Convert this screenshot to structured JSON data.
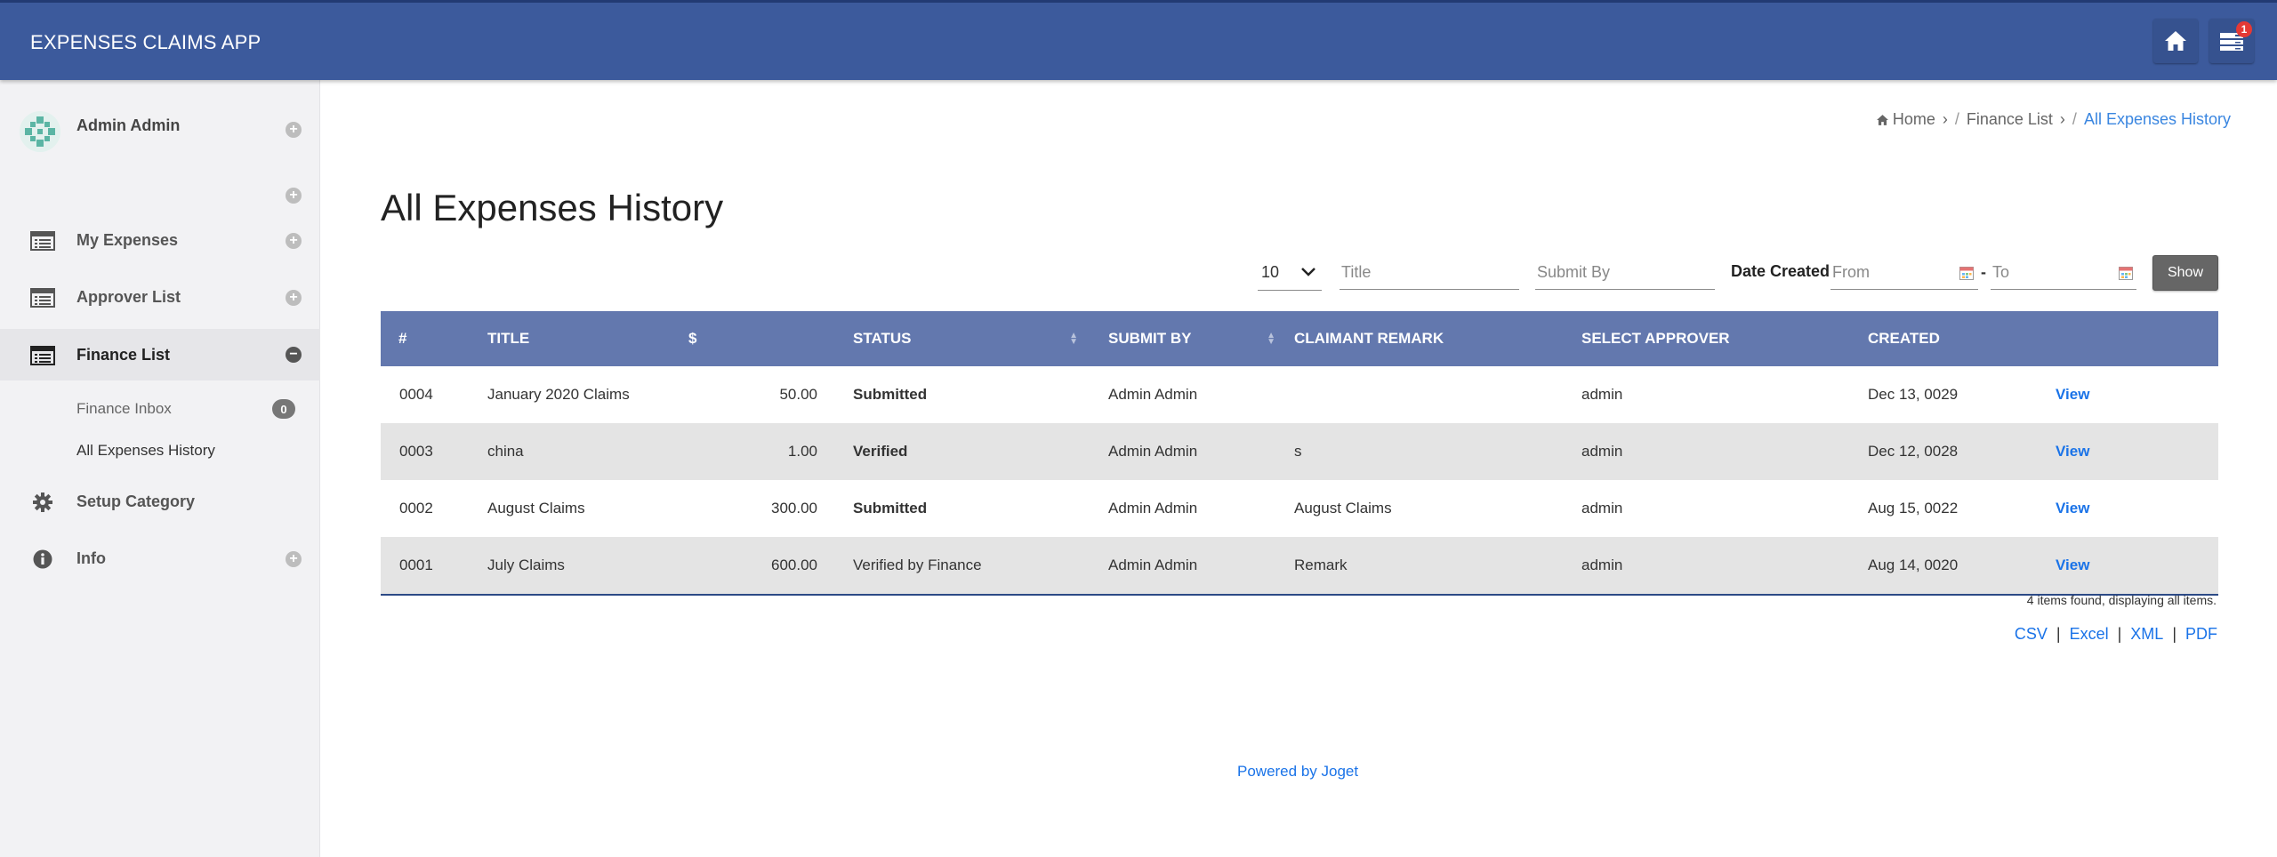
{
  "app": {
    "title": "EXPENSES CLAIMS APP",
    "notification_count": "1"
  },
  "header_icons": {
    "home": "home-icon",
    "tasks": "inbox-tray-icon"
  },
  "user": {
    "name": "Admin Admin",
    "avatar": "avatar-icon"
  },
  "sidebar": {
    "items": [
      {
        "label": "My Expenses",
        "icon": "list-icon",
        "toggle": "+"
      },
      {
        "label": "Approver List",
        "icon": "list-icon",
        "toggle": "+"
      },
      {
        "label": "Finance List",
        "icon": "list-icon",
        "toggle": "−"
      },
      {
        "label": "Setup Category",
        "icon": "gear-icon"
      },
      {
        "label": "Info",
        "icon": "info-icon",
        "toggle": "+"
      }
    ],
    "sub_items": [
      {
        "label": "Finance Inbox",
        "count": "0"
      },
      {
        "label": "All Expenses History"
      }
    ]
  },
  "breadcrumb": {
    "home": "Home",
    "parent": "Finance List",
    "current": "All Expenses History"
  },
  "page": {
    "title": "All Expenses History"
  },
  "filters": {
    "page_size": "10",
    "title_placeholder": "Title",
    "submit_by_placeholder": "Submit By",
    "date_label": "Date Created",
    "from_placeholder": "From",
    "to_placeholder": "To",
    "separator": "-",
    "show_label": "Show"
  },
  "table": {
    "columns": [
      "#",
      "TITLE",
      "$",
      "STATUS",
      "SUBMIT BY",
      "CLAIMANT REMARK",
      "SELECT APPROVER",
      "CREATED"
    ],
    "rows": [
      {
        "id": "0004",
        "title": "January 2020 Claims",
        "amount": "50.00",
        "status": "Submitted",
        "status_style": "submitted",
        "submit_by": "Admin Admin",
        "remark": "",
        "approver": "admin",
        "created": "Dec 13, 0029",
        "action": "View"
      },
      {
        "id": "0003",
        "title": "china",
        "amount": "1.00",
        "status": "Verified",
        "status_style": "verified",
        "submit_by": "Admin Admin",
        "remark": "s",
        "approver": "admin",
        "created": "Dec 12, 0028",
        "action": "View"
      },
      {
        "id": "0002",
        "title": "August Claims",
        "amount": "300.00",
        "status": "Submitted",
        "status_style": "submitted",
        "submit_by": "Admin Admin",
        "remark": "August Claims",
        "approver": "admin",
        "created": "Aug 15, 0022",
        "action": "View"
      },
      {
        "id": "0001",
        "title": "July Claims",
        "amount": "600.00",
        "status": "Verified by Finance",
        "status_style": "plain",
        "submit_by": "Admin Admin",
        "remark": "Remark",
        "approver": "admin",
        "created": "Aug 14, 0020",
        "action": "View"
      }
    ],
    "found_text": "4 items found, displaying all items."
  },
  "exports": {
    "csv": "CSV",
    "excel": "Excel",
    "xml": "XML",
    "pdf": "PDF",
    "separator": "|"
  },
  "footer": {
    "powered": "Powered by Joget"
  },
  "colors": {
    "header": "#3c5a9c",
    "table_header": "#6378ae",
    "link": "#1a73e8",
    "submitted": "#f39c12",
    "verified": "#2e8b2e"
  }
}
